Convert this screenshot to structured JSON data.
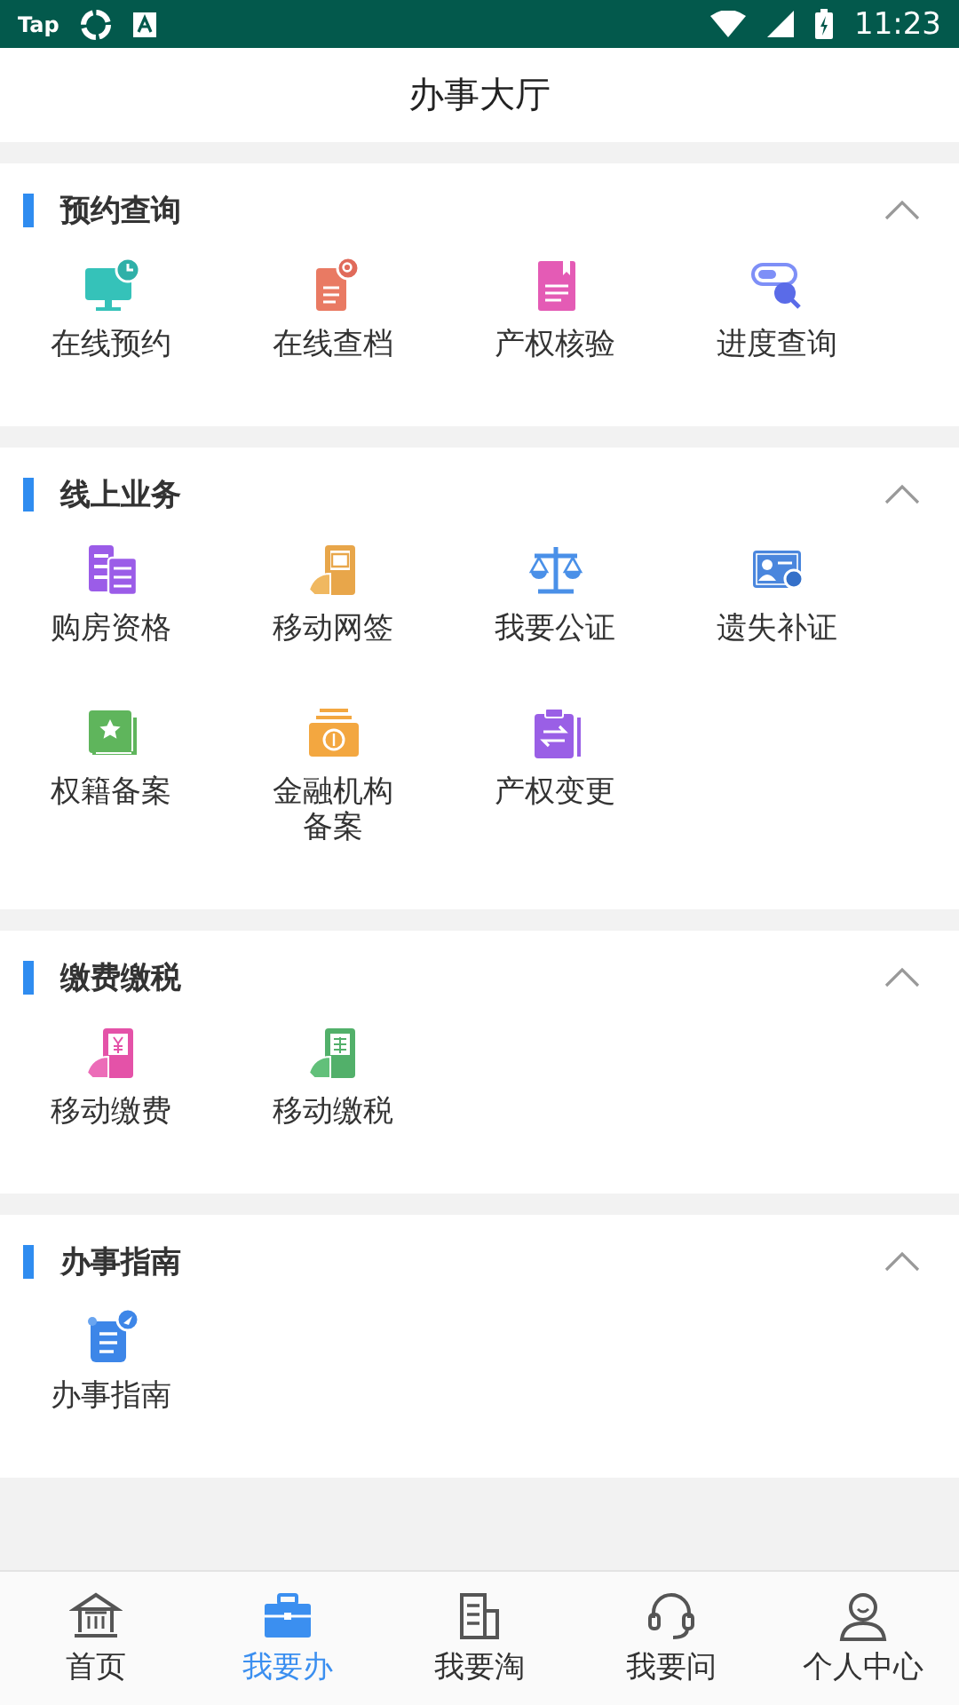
{
  "status_bar": {
    "app_label": "Tap",
    "time": "11:23"
  },
  "header": {
    "title": "办事大厅"
  },
  "sections": [
    {
      "title": "预约查询",
      "expanded": true,
      "items": [
        {
          "label": "在线预约"
        },
        {
          "label": "在线查档"
        },
        {
          "label": "产权核验"
        },
        {
          "label": "进度查询"
        }
      ]
    },
    {
      "title": "线上业务",
      "expanded": true,
      "items": [
        {
          "label": "购房资格"
        },
        {
          "label": "移动网签"
        },
        {
          "label": "我要公证"
        },
        {
          "label": "遗失补证"
        },
        {
          "label": "权籍备案"
        },
        {
          "label": "金融机构备案"
        },
        {
          "label": "产权变更"
        }
      ]
    },
    {
      "title": "缴费缴税",
      "expanded": true,
      "items": [
        {
          "label": "移动缴费"
        },
        {
          "label": "移动缴税"
        }
      ]
    },
    {
      "title": "办事指南",
      "expanded": true,
      "items": [
        {
          "label": "办事指南"
        }
      ]
    }
  ],
  "tab_bar": [
    {
      "label": "首页",
      "selected": false
    },
    {
      "label": "我要办",
      "selected": true
    },
    {
      "label": "我要淘",
      "selected": false
    },
    {
      "label": "我要问",
      "selected": false
    },
    {
      "label": "个人中心",
      "selected": false
    }
  ]
}
